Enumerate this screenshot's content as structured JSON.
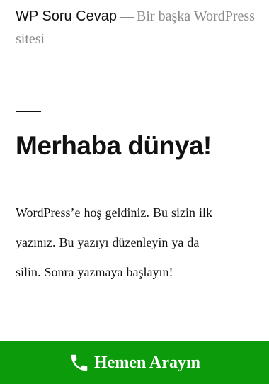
{
  "header": {
    "site_title": "WP Soru Cevap",
    "separator": "—",
    "tagline": "Bir başka WordPress sitesi"
  },
  "post": {
    "title": "Merhaba dünya!",
    "content_lines": [
      "WordPress’e hoş geldiniz. Bu sizin ilk",
      "yazınız. Bu yazıyı düzenleyin ya da",
      "silin. Sonra yazmaya başlayın!"
    ]
  },
  "call_button": {
    "label": "Hemen Arayın",
    "icon": "phone-icon",
    "background_color": "#0b9b0b",
    "text_color": "#ffffff"
  }
}
